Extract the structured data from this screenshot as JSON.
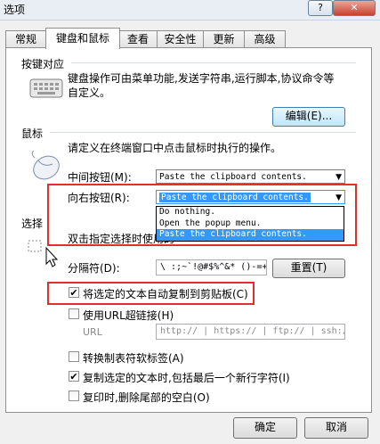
{
  "window": {
    "title": "选项",
    "help_button": "?",
    "close_button": "✕"
  },
  "tabs": [
    "常规",
    "键盘和鼠标",
    "查看",
    "安全性",
    "更新",
    "高级"
  ],
  "keyboard": {
    "section_title": "按键对应",
    "description_line1": "键盘操作可由菜单功能,发送字符串,运行脚本,协议命令等",
    "description_line2": "自定义。",
    "edit_button": "编辑(E)..."
  },
  "mouse": {
    "section_title": "鼠标",
    "description": "请定义在终端窗口中点击鼠标时执行的操作。",
    "middle_label": "中间按钮(M):",
    "middle_value": "Paste the clipboard contents.",
    "right_label": "向右按钮(R):",
    "right_value": "Paste the clipboard contents.",
    "right_options": [
      "Do nothing.",
      "Open the popup menu.",
      "Paste the clipboard contents."
    ]
  },
  "selection": {
    "section_title": "选择",
    "double_click_label": "双击指定选择时使用的",
    "separator_label": "分隔符(D):",
    "separator_value": "\\ :;~`!@#$%^&* ()-=+|",
    "reset_button": "重置(T)",
    "auto_copy_label": "将选定的文本自动复制到剪贴板(C)",
    "use_url_label": "使用URL超链接(H)",
    "url_label": "URL",
    "url_value": "http:// | https:// | ftp:// | ssh:/"
  },
  "options": {
    "tab_to_space": "转换制表符软标签(A)",
    "copy_newline": "复制选定的文本时,包括最后一个新行字符(I)",
    "trim_trailing": "复印时,删除尾部的空白(O)"
  },
  "footer": {
    "ok": "确定",
    "cancel": "取消"
  },
  "checkbox_states": {
    "auto_copy": true,
    "use_url": false,
    "tab_to_space": false,
    "copy_newline": true,
    "trim_trailing": false
  },
  "colors": {
    "highlight": "#3399ff",
    "annotation": "#e0302b"
  },
  "icons": {
    "keyboard": "keyboard-icon",
    "mouse": "mouse-icon",
    "cursor": "cursor-icon"
  }
}
